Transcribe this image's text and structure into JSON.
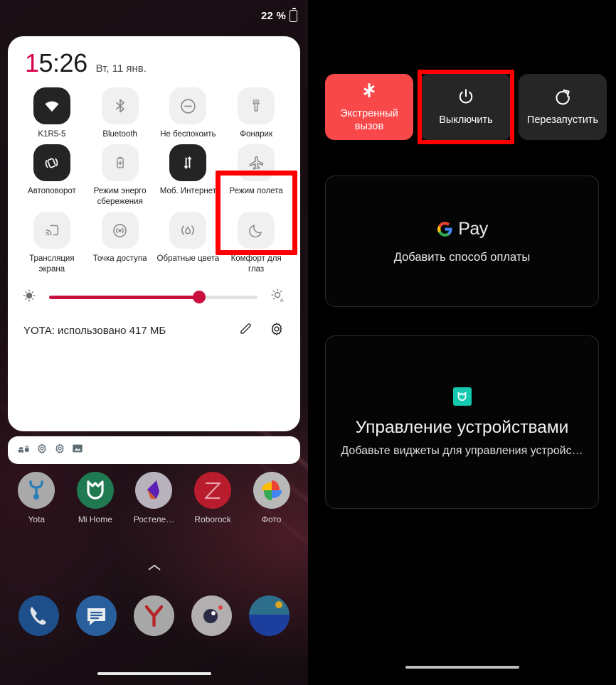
{
  "left_phone": {
    "status_bar": {
      "battery_percent": "22 %",
      "battery_icon": "battery-icon"
    },
    "quick_settings": {
      "time": "15:26",
      "time_first_char": "1",
      "time_rest": "5:26",
      "date": "Вт, 11 янв.",
      "tiles": [
        {
          "label": "K1R5-5",
          "icon": "wifi-icon",
          "active": true
        },
        {
          "label": "Bluetooth",
          "icon": "bluetooth-icon",
          "active": false
        },
        {
          "label": "Не беспокоить",
          "icon": "do-not-disturb-icon",
          "active": false
        },
        {
          "label": "Фонарик",
          "icon": "flashlight-icon",
          "active": false
        },
        {
          "label": "Автоповорот",
          "icon": "auto-rotate-icon",
          "active": true
        },
        {
          "label": "Режим энерго сбережения",
          "icon": "battery-saver-icon",
          "active": false
        },
        {
          "label": "Моб. Интернет",
          "icon": "mobile-data-icon",
          "active": true
        },
        {
          "label": "Режим полета",
          "icon": "airplane-mode-icon",
          "active": false
        },
        {
          "label": "Трансляция экрана",
          "icon": "cast-icon",
          "active": false
        },
        {
          "label": "Точка доступа",
          "icon": "hotspot-icon",
          "active": false
        },
        {
          "label": "Обратные цвета",
          "icon": "invert-colors-icon",
          "active": false
        },
        {
          "label": "Комфорт для глаз",
          "icon": "night-light-icon",
          "active": false
        }
      ],
      "brightness": {
        "low_icon": "brightness-low-icon",
        "auto_icon": "brightness-auto-icon",
        "value_percent": 72
      },
      "footer": {
        "data_usage": "YOTA: использовано 417 МБ",
        "edit_icon": "pencil-icon",
        "settings_icon": "gear-icon"
      }
    },
    "notification_strip": {
      "icons": [
        "car-lock-icon",
        "settings-gear-small-icon",
        "settings-gear-small-icon",
        "image-icon"
      ]
    },
    "home_apps": [
      {
        "label": "Yota",
        "icon": "yota-app-icon"
      },
      {
        "label": "Mi Home",
        "icon": "mihome-app-icon"
      },
      {
        "label": "Ростеле…",
        "icon": "rostelecom-app-icon"
      },
      {
        "label": "Roborock",
        "icon": "roborock-app-icon"
      },
      {
        "label": "Фото",
        "icon": "google-photos-app-icon"
      }
    ],
    "drawer_arrow_icon": "chevron-up-icon",
    "dock_apps": [
      {
        "icon": "phone-app-icon"
      },
      {
        "icon": "messages-app-icon"
      },
      {
        "icon": "yandex-browser-app-icon"
      },
      {
        "icon": "camera-app-icon"
      },
      {
        "icon": "gallery-app-icon"
      }
    ]
  },
  "right_phone": {
    "power_menu": [
      {
        "label": "Экстренный вызов",
        "icon": "emergency-star-icon",
        "style": "emergency",
        "highlighted": false
      },
      {
        "label": "Выключить",
        "icon": "power-icon",
        "style": "dark",
        "highlighted": true
      },
      {
        "label": "Перезапустить",
        "icon": "restart-icon",
        "style": "dark",
        "highlighted": false
      }
    ],
    "gpay_card": {
      "logo_g": "G",
      "logo_word": "Pay",
      "subtitle": "Добавить способ оплаты"
    },
    "devices_card": {
      "badge_icon": "mihome-badge-icon",
      "title": "Управление устройствами",
      "subtitle": "Добавьте виджеты для управления устройс…"
    }
  },
  "colors": {
    "accent_red": "#c8103c",
    "highlight_red": "#ff0000",
    "emergency_red": "#f9484a",
    "panel_white": "#ffffff",
    "tile_on": "#242424",
    "tile_off": "#f0f0f0",
    "mi_teal": "#15c9b0"
  }
}
